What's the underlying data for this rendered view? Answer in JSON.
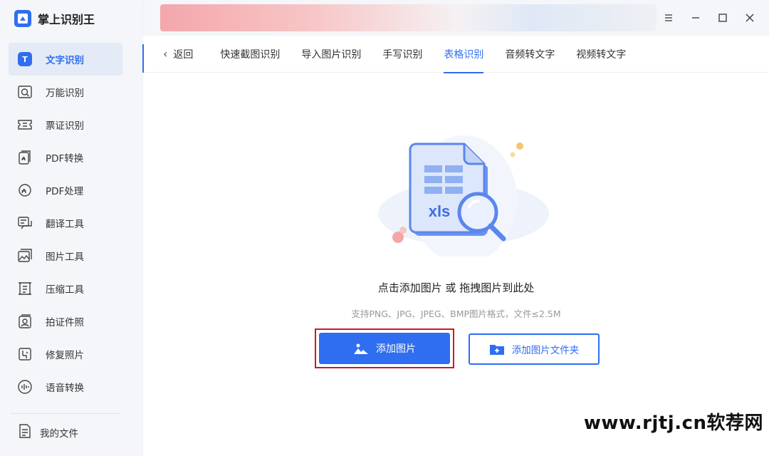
{
  "app": {
    "title": "掌上识别王"
  },
  "sidebar": {
    "items": [
      {
        "label": "文字识别",
        "icon": "text-recognition-icon",
        "active": true,
        "glyph": "T"
      },
      {
        "label": "万能识别",
        "icon": "universal-scan-icon"
      },
      {
        "label": "票证识别",
        "icon": "ticket-icon"
      },
      {
        "label": "PDF转换",
        "icon": "pdf-convert-icon"
      },
      {
        "label": "PDF处理",
        "icon": "pdf-process-icon"
      },
      {
        "label": "翻译工具",
        "icon": "translate-icon"
      },
      {
        "label": "图片工具",
        "icon": "image-tool-icon"
      },
      {
        "label": "压缩工具",
        "icon": "compress-icon"
      },
      {
        "label": "拍证件照",
        "icon": "id-photo-icon"
      },
      {
        "label": "修复照片",
        "icon": "repair-photo-icon"
      },
      {
        "label": "语音转换",
        "icon": "voice-convert-icon"
      }
    ],
    "my_files": "我的文件"
  },
  "tabs": {
    "back": "返回",
    "items": [
      "快速截图识别",
      "导入图片识别",
      "手写识别",
      "表格识别",
      "音频转文字",
      "视频转文字"
    ],
    "active_index": 3
  },
  "upload": {
    "file_badge": "xls",
    "prompt": "点击添加图片 或 拖拽图片到此处",
    "support": "支持PNG、JPG、JPEG、BMP图片格式，文件≤2.5M",
    "add_image": "添加图片",
    "add_folder": "添加图片文件夹"
  },
  "watermark": "www.rjtj.cn软荐网",
  "colors": {
    "accent": "#2f6ef0",
    "highlight": "#d0181f"
  }
}
